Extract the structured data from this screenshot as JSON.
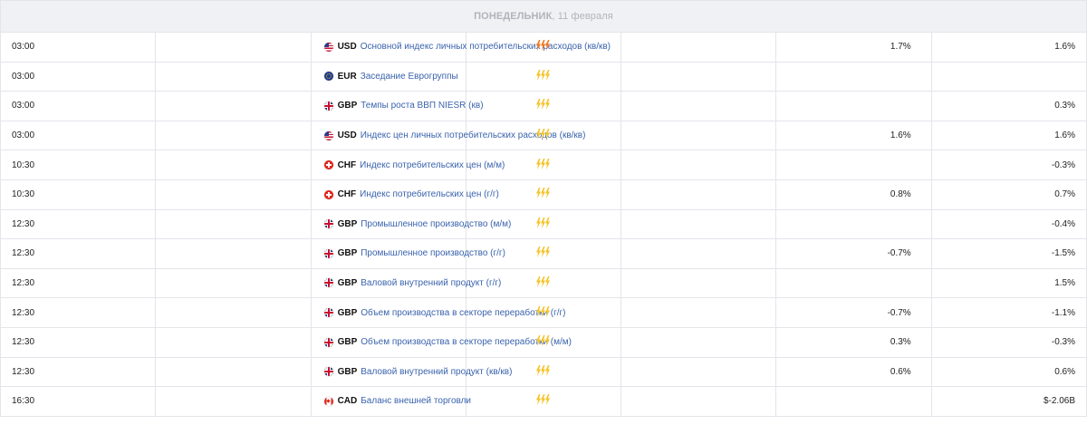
{
  "date_header": {
    "weekday": "ПОНЕДЕЛЬНИК",
    "date": ", 11 февраля"
  },
  "volatility_colors": {
    "high": "#f5781f",
    "medium": "#f5c42a"
  },
  "events": [
    {
      "time": "03:00",
      "currency": "USD",
      "flag": "usd",
      "name": "Основной индекс личных потребительских расходов (кв/кв)",
      "volatility": "high",
      "forecast": "1.7%",
      "previous": "1.6%"
    },
    {
      "time": "03:00",
      "currency": "EUR",
      "flag": "eur",
      "name": "Заседание Еврогруппы",
      "volatility": "medium",
      "forecast": "",
      "previous": ""
    },
    {
      "time": "03:00",
      "currency": "GBP",
      "flag": "gbp",
      "name": "Темпы роста ВВП NIESR (кв)",
      "volatility": "medium",
      "forecast": "",
      "previous": "0.3%"
    },
    {
      "time": "03:00",
      "currency": "USD",
      "flag": "usd",
      "name": "Индекс цен личных потребительских расходов (кв/кв)",
      "volatility": "medium",
      "forecast": "1.6%",
      "previous": "1.6%"
    },
    {
      "time": "10:30",
      "currency": "CHF",
      "flag": "chf",
      "name": "Индекс потребительских цен (м/м)",
      "volatility": "medium",
      "forecast": "",
      "previous": "-0.3%"
    },
    {
      "time": "10:30",
      "currency": "CHF",
      "flag": "chf",
      "name": "Индекс потребительских цен (г/г)",
      "volatility": "medium",
      "forecast": "0.8%",
      "previous": "0.7%"
    },
    {
      "time": "12:30",
      "currency": "GBP",
      "flag": "gbp",
      "name": "Промышленное производство (м/м)",
      "volatility": "medium",
      "forecast": "",
      "previous": "-0.4%"
    },
    {
      "time": "12:30",
      "currency": "GBP",
      "flag": "gbp",
      "name": "Промышленное производство (г/г)",
      "volatility": "medium",
      "forecast": "-0.7%",
      "previous": "-1.5%"
    },
    {
      "time": "12:30",
      "currency": "GBP",
      "flag": "gbp",
      "name": "Валовой внутренний продукт (г/г)",
      "volatility": "medium",
      "forecast": "",
      "previous": "1.5%"
    },
    {
      "time": "12:30",
      "currency": "GBP",
      "flag": "gbp",
      "name": "Объем производства в секторе переработки (г/г)",
      "volatility": "medium",
      "forecast": "-0.7%",
      "previous": "-1.1%"
    },
    {
      "time": "12:30",
      "currency": "GBP",
      "flag": "gbp",
      "name": "Объем производства в секторе переработки (м/м)",
      "volatility": "medium",
      "forecast": "0.3%",
      "previous": "-0.3%"
    },
    {
      "time": "12:30",
      "currency": "GBP",
      "flag": "gbp",
      "name": "Валовой внутренний продукт (кв/кв)",
      "volatility": "medium",
      "forecast": "0.6%",
      "previous": "0.6%"
    },
    {
      "time": "16:30",
      "currency": "CAD",
      "flag": "cad",
      "name": "Баланс внешней торговли",
      "volatility": "medium",
      "forecast": "",
      "previous": "$-2.06B"
    }
  ]
}
